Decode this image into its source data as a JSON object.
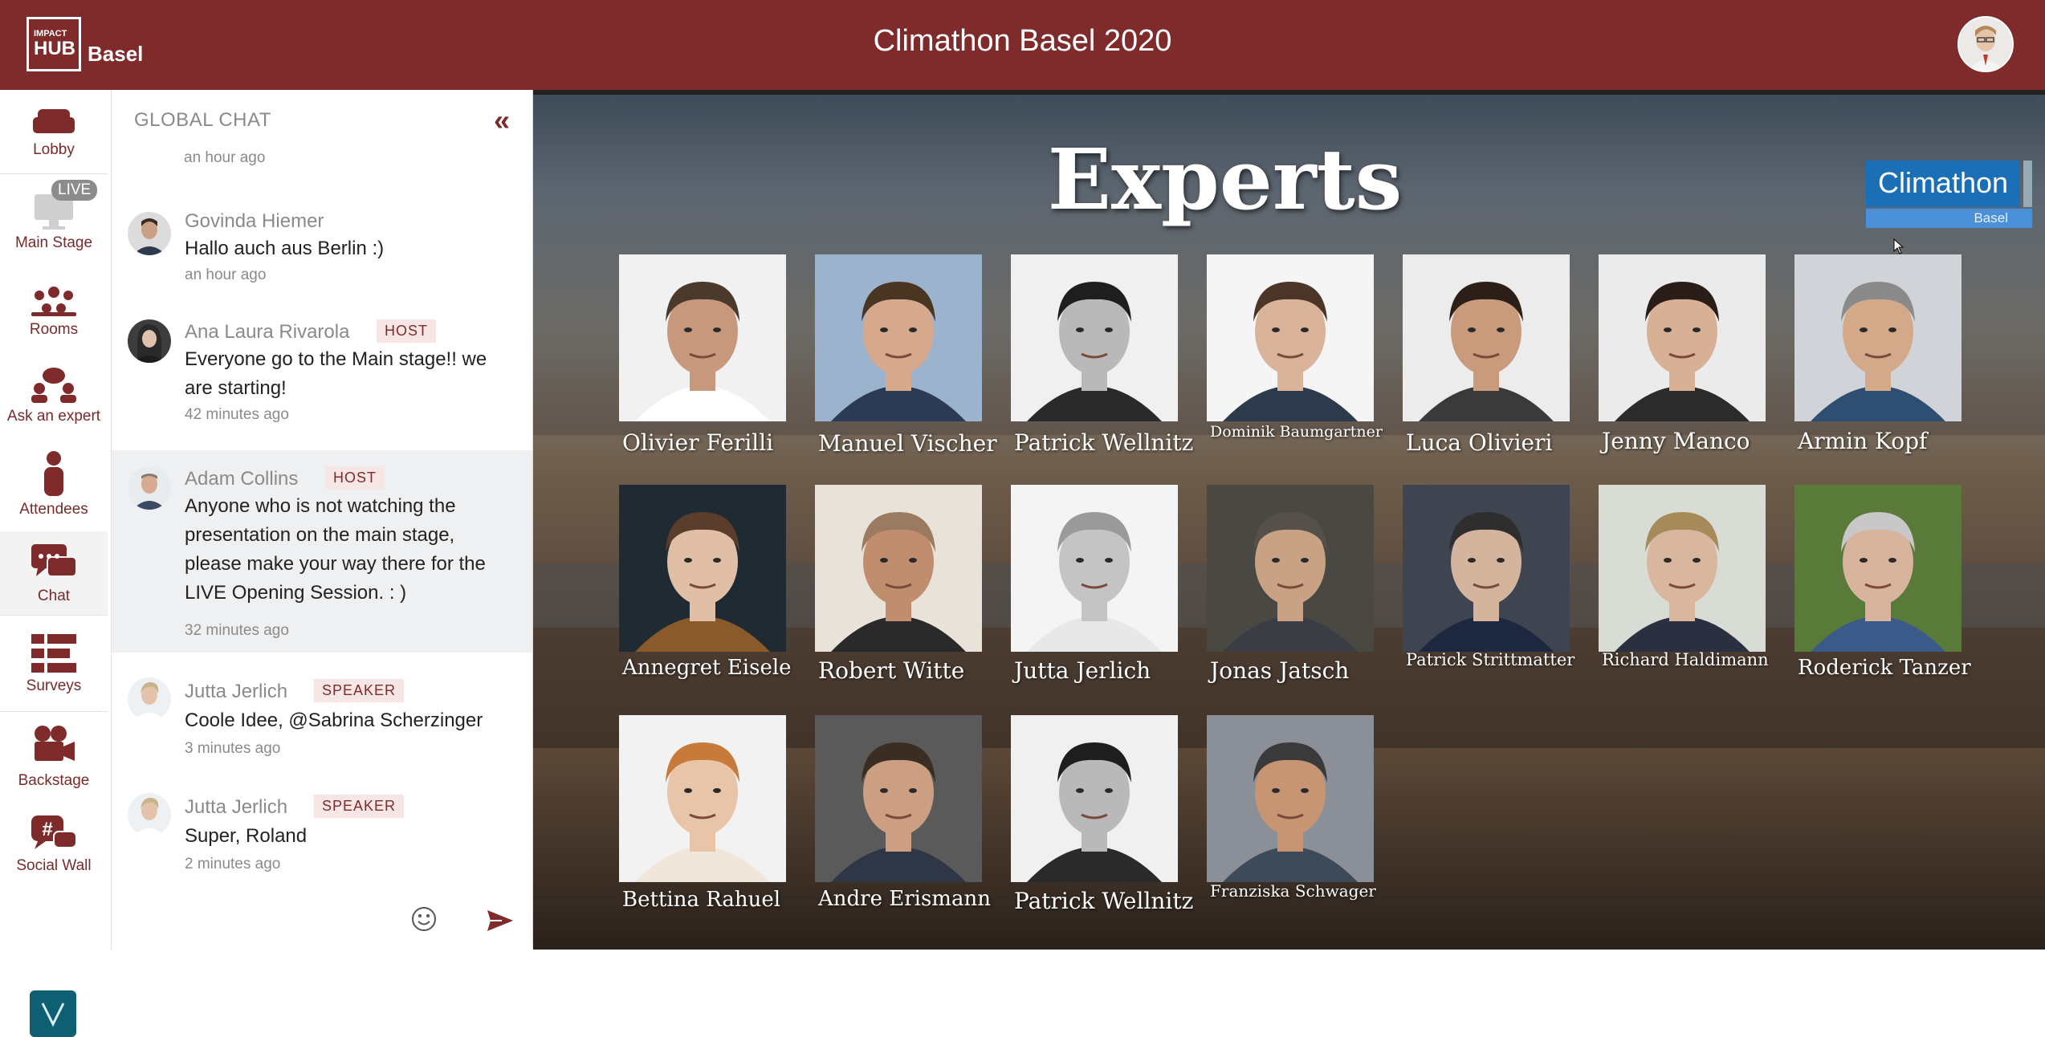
{
  "header": {
    "logo_line1": "IMPACT",
    "logo_line2": "HUB",
    "logo_city": "Basel",
    "title": "Climathon Basel 2020"
  },
  "nav": {
    "live_badge": "LIVE",
    "items": [
      {
        "label": "Lobby",
        "icon": "sofa-icon"
      },
      {
        "label": "Main Stage",
        "icon": "monitor-icon"
      },
      {
        "label": "Rooms",
        "icon": "people-group-icon"
      },
      {
        "label": "Ask an expert",
        "icon": "expert-chat-icon"
      },
      {
        "label": "Attendees",
        "icon": "person-icon"
      },
      {
        "label": "Chat",
        "icon": "chat-bubbles-icon"
      },
      {
        "label": "Surveys",
        "icon": "survey-icon"
      },
      {
        "label": "Backstage",
        "icon": "video-camera-icon"
      },
      {
        "label": "Social Wall",
        "icon": "hashtag-chat-icon"
      }
    ],
    "accent": "#7f2a2b"
  },
  "chat": {
    "title": "GLOBAL CHAT",
    "first_time": "an hour ago",
    "messages": [
      {
        "name": "Govinda Hiemer",
        "badge": "",
        "text": "Hallo auch aus Berlin :)",
        "time": "an hour ago"
      },
      {
        "name": "Ana Laura Rivarola",
        "badge": "HOST",
        "text": "Everyone go to the Main stage!! we are starting!",
        "time": "42 minutes ago"
      },
      {
        "name": "Adam Collins",
        "badge": "HOST",
        "text": "Anyone who is not watching the presentation on the main stage, please make your way there for the LIVE Opening Session. : )",
        "time": "32 minutes ago"
      },
      {
        "name": "Jutta Jerlich",
        "badge": "SPEAKER",
        "text": "Coole Idee, @Sabrina Scherzinger",
        "time": "3 minutes ago"
      },
      {
        "name": "Jutta Jerlich",
        "badge": "SPEAKER",
        "text": "Super, Roland",
        "time": "2 minutes ago"
      }
    ],
    "input_value": ""
  },
  "stage": {
    "title": "Experts",
    "badge_top": "Climathon",
    "badge_bottom": "Basel",
    "experts": [
      "Olivier Ferilli",
      "Manuel Vischer",
      "Patrick Wellnitz",
      "Dominik Baumgartner",
      "Luca Olivieri",
      "Jenny Manco",
      "Armin Kopf",
      "Annegret Eisele",
      "Robert Witte",
      "Jutta Jerlich",
      "Jonas Jatsch",
      "Patrick Strittmatter",
      "Richard Haldimann",
      "Roderick Tanzer",
      "Bettina Rahuel",
      "Andre Erismann",
      "Patrick Wellnitz",
      "Franziska Schwager"
    ]
  }
}
